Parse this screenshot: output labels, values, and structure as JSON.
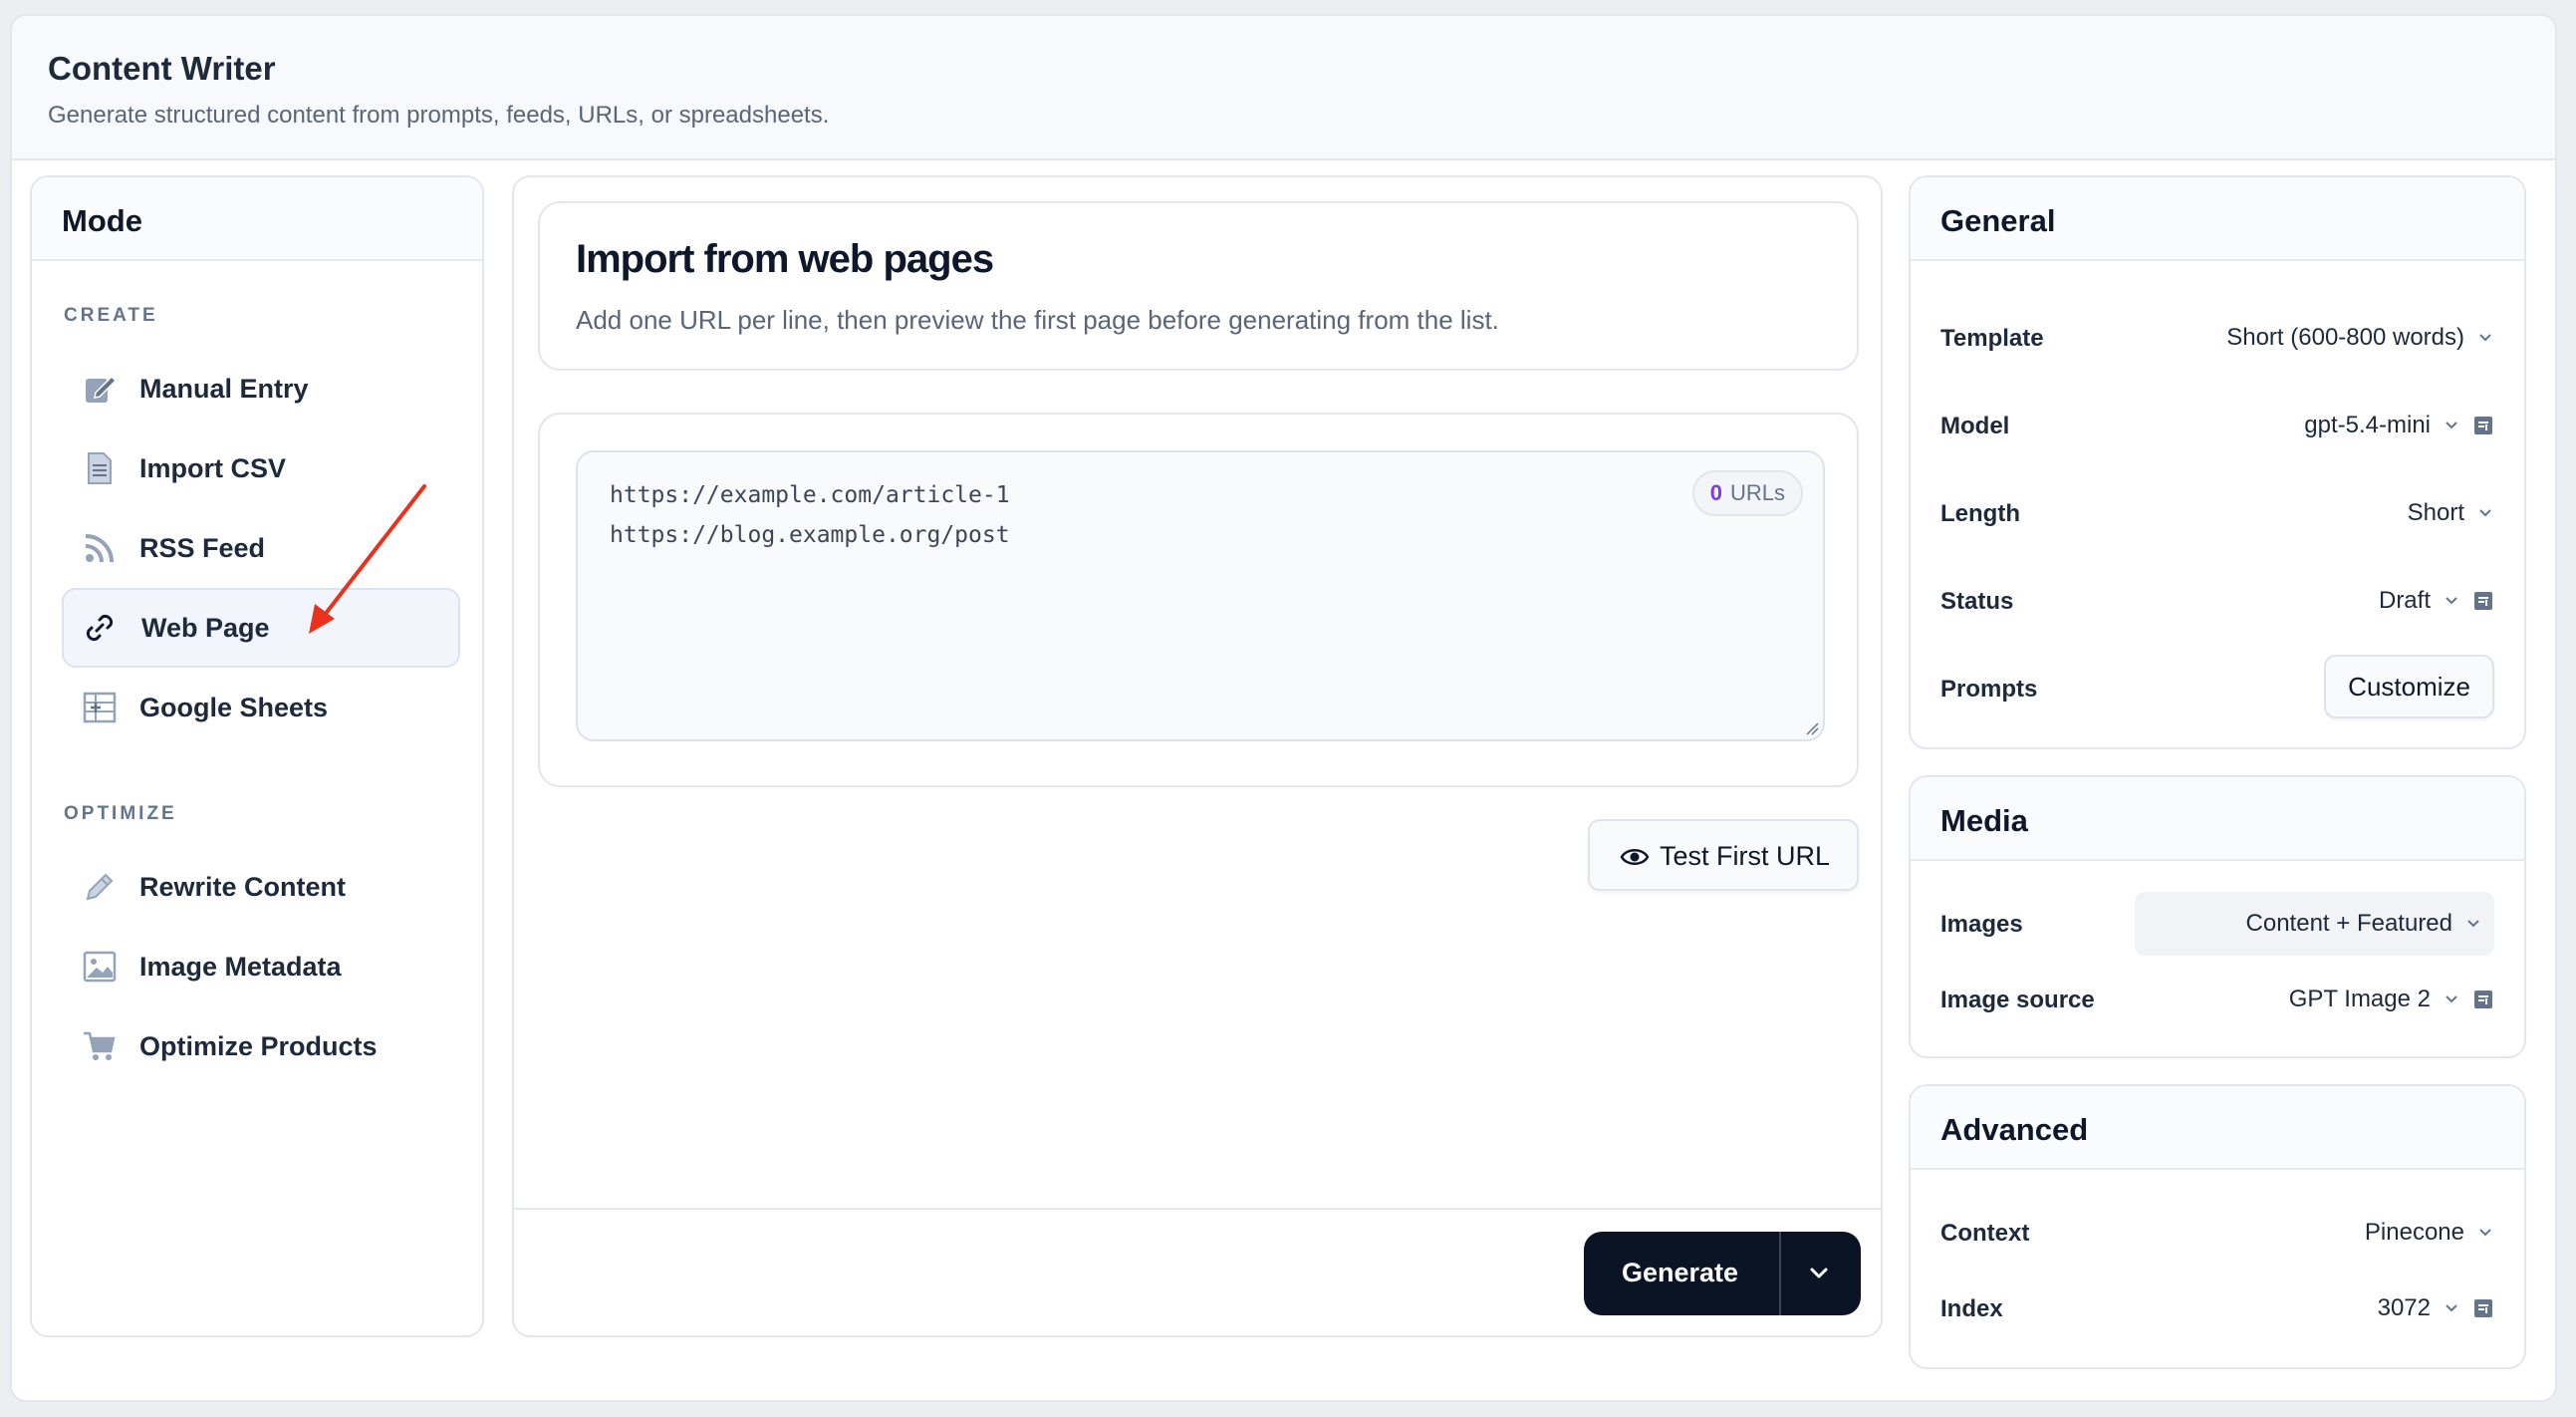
{
  "app": {
    "title": "Content Writer",
    "subtitle": "Generate structured content from prompts, feeds, URLs, or spreadsheets."
  },
  "sidebar": {
    "title": "Mode",
    "sections": [
      {
        "label": "CREATE"
      },
      {
        "label": "OPTIMIZE"
      }
    ],
    "items": [
      {
        "label": "Manual Entry",
        "icon": "edit-icon"
      },
      {
        "label": "Import CSV",
        "icon": "file-icon"
      },
      {
        "label": "RSS Feed",
        "icon": "rss-icon"
      },
      {
        "label": "Web Page",
        "icon": "link-icon",
        "active": true
      },
      {
        "label": "Google Sheets",
        "icon": "table-icon"
      },
      {
        "label": "Rewrite Content",
        "icon": "pencil-icon"
      },
      {
        "label": "Image Metadata",
        "icon": "image-icon"
      },
      {
        "label": "Optimize Products",
        "icon": "cart-icon"
      }
    ]
  },
  "main": {
    "title": "Import from web pages",
    "description": "Add one URL per line, then preview the first page before generating from the list.",
    "urls": [
      "https://example.com/article-1",
      "https://blog.example.org/post"
    ],
    "url_count": "0",
    "url_count_label": "URLs",
    "test_button": "Test First URL",
    "generate_button": "Generate"
  },
  "general": {
    "title": "General",
    "rows": [
      {
        "label": "Template",
        "value": "Short (600-800 words)"
      },
      {
        "label": "Model",
        "value": "gpt-5.4-mini"
      },
      {
        "label": "Length",
        "value": "Short"
      },
      {
        "label": "Status",
        "value": "Draft"
      },
      {
        "label": "Prompts",
        "value": "Customize"
      }
    ]
  },
  "media": {
    "title": "Media",
    "rows": [
      {
        "label": "Images",
        "value": "Content + Featured"
      },
      {
        "label": "Image source",
        "value": "GPT Image 2"
      }
    ]
  },
  "advanced": {
    "title": "Advanced",
    "rows": [
      {
        "label": "Context",
        "value": "Pinecone"
      },
      {
        "label": "Index",
        "value": "3072"
      }
    ]
  },
  "colors": {
    "accent": "#7c3aed",
    "primary_button": "#0b1424",
    "annotation_arrow": "#e8321e"
  }
}
